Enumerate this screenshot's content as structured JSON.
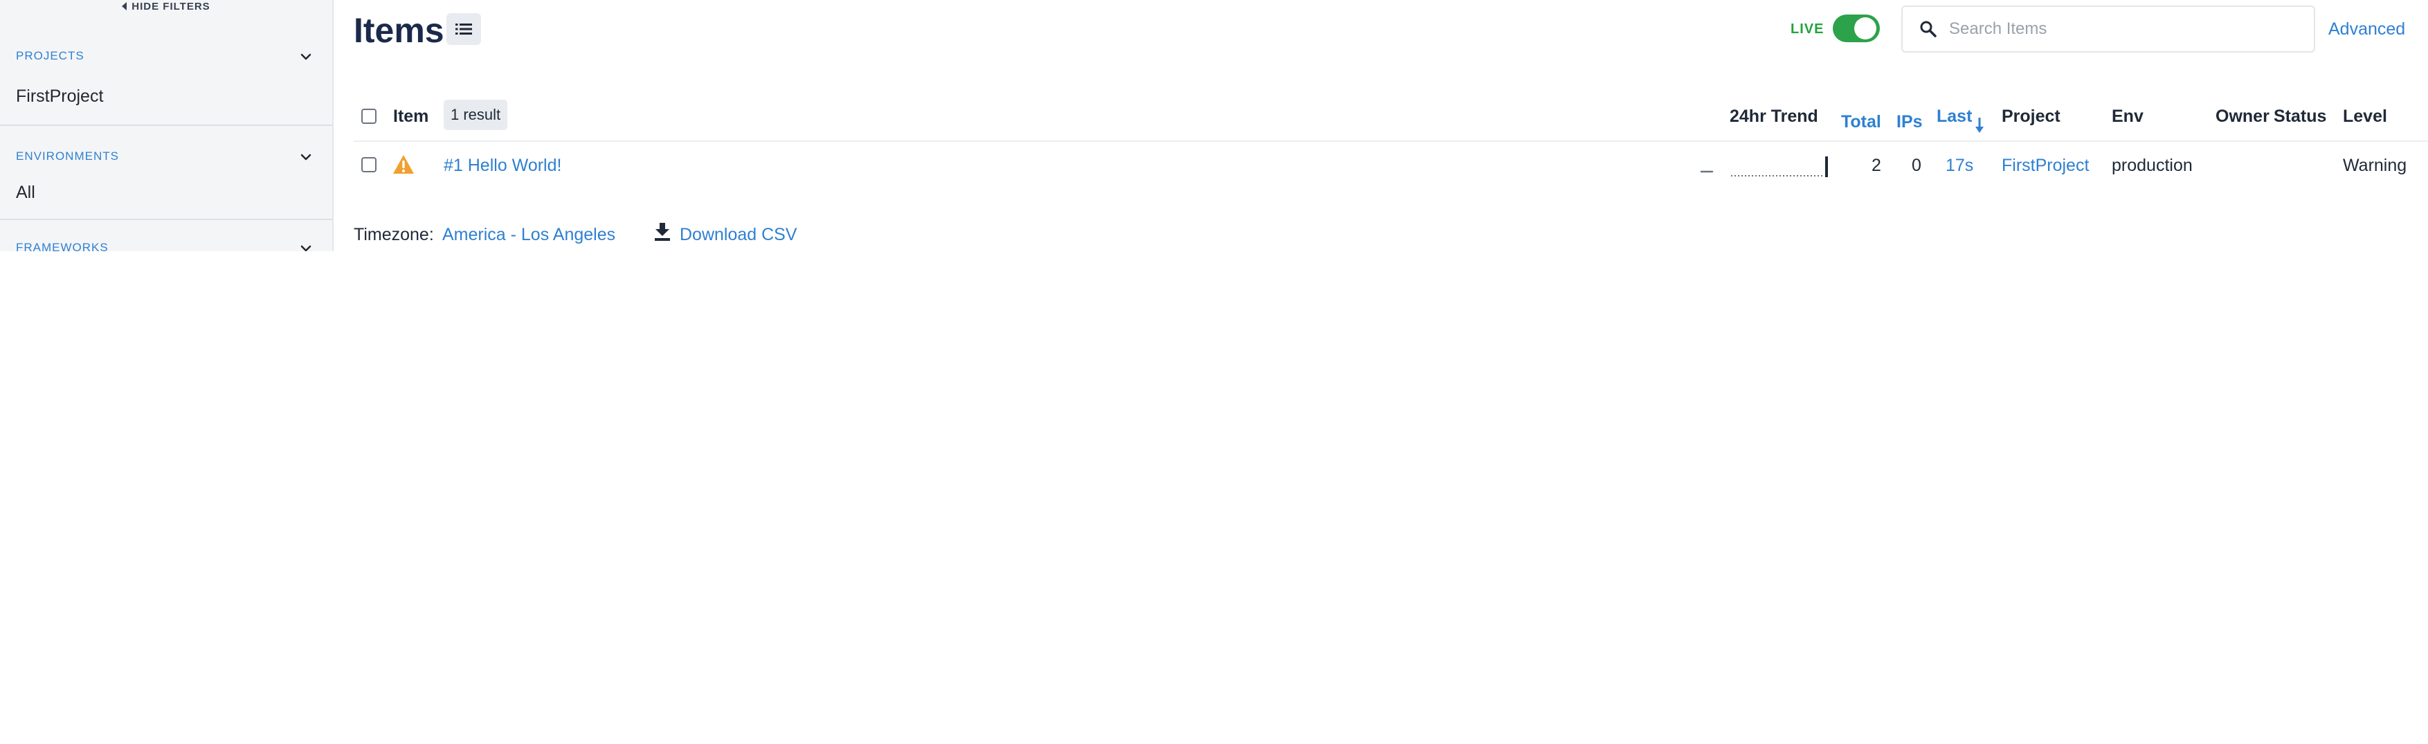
{
  "sidebar": {
    "hide_filters_label": "HIDE FILTERS",
    "sections": [
      {
        "heading": "PROJECTS",
        "value": "FirstProject"
      },
      {
        "heading": "ENVIRONMENTS",
        "value": "All"
      },
      {
        "heading": "FRAMEWORKS",
        "value": ""
      }
    ]
  },
  "header": {
    "title": "Items",
    "live_label": "LIVE",
    "live_enabled": true,
    "search_placeholder": "Search Items",
    "search_value": "",
    "advanced_label": "Advanced"
  },
  "table": {
    "columns": {
      "item": "Item",
      "result_count": "1 result",
      "trend": "24hr Trend",
      "total": "Total",
      "ips": "IPs",
      "last": "Last",
      "project": "Project",
      "env": "Env",
      "owner": "Owner",
      "status": "Status",
      "level": "Level"
    },
    "rows": [
      {
        "title": "#1 Hello World!",
        "level_icon": "warning-icon",
        "total": "2",
        "ips": "0",
        "last": "17s",
        "project": "FirstProject",
        "env": "production",
        "owner": "",
        "status": "",
        "level": "Warning"
      }
    ]
  },
  "footer": {
    "timezone_label": "Timezone:",
    "timezone_value": "America - Los Angeles",
    "download_label": "Download CSV"
  },
  "colors": {
    "accent": "#2f80d1",
    "live_green": "#2ca24a",
    "warning": "#f0a030",
    "title_navy": "#1b2a4a"
  }
}
